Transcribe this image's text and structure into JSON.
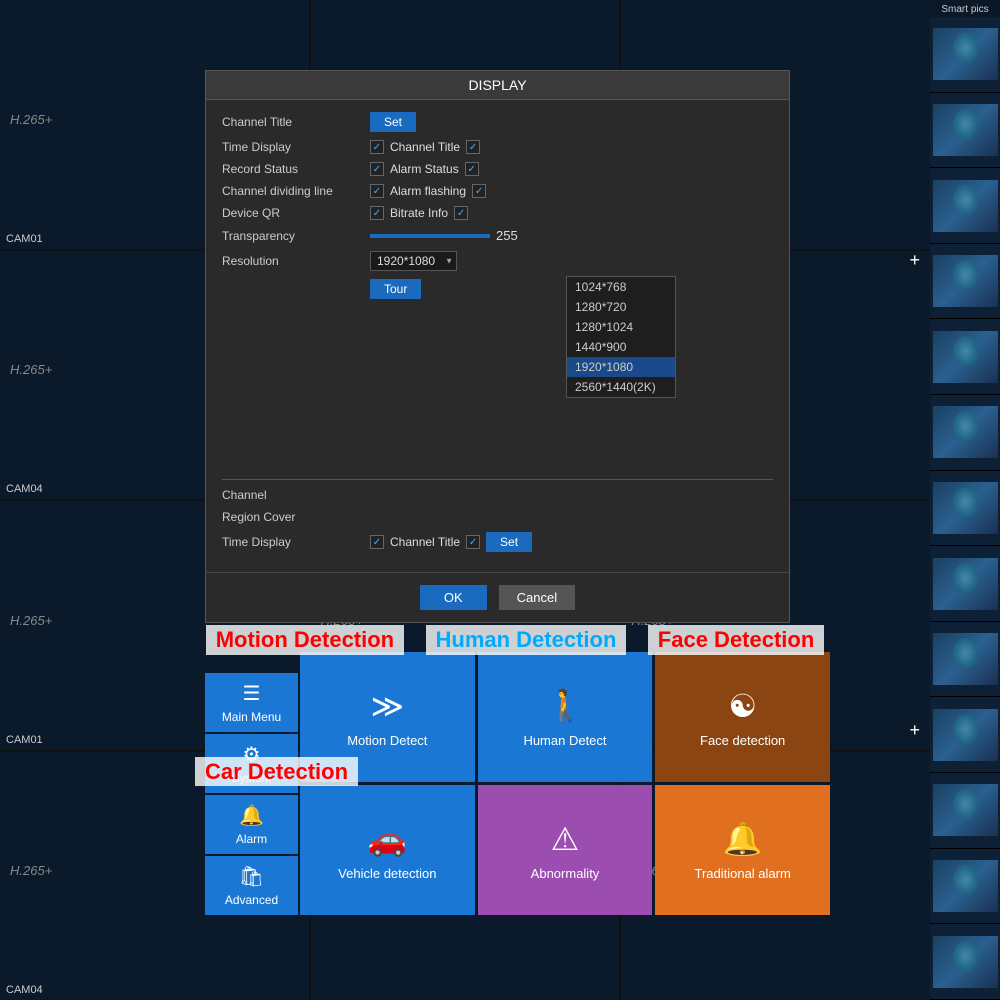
{
  "dialog": {
    "title": "DISPLAY",
    "channel_title_label": "Channel Title",
    "time_display_label": "Time Display",
    "record_status_label": "Record Status",
    "channel_dividing_label": "Channel dividing line",
    "device_qr_label": "Device QR",
    "transparency_label": "Transparency",
    "resolution_label": "Resolution",
    "channel_label": "Channel",
    "region_cover_label": "Region Cover",
    "time_display2_label": "Time Display",
    "set_button": "Set",
    "tour_button": "Tour",
    "set_button2": "Set",
    "ok_button": "OK",
    "cancel_button": "Cancel",
    "transparency_value": "255",
    "resolution_current": "1920*1080",
    "channel_title_checkbox": true,
    "alarm_status_label": "Alarm Status",
    "alarm_flashing_label": "Alarm flashing",
    "bitrate_info_label": "Bitrate Info",
    "resolution_options": [
      "1024*768",
      "1280*720",
      "1280*1024",
      "1440*900",
      "1920*1080",
      "2560*1440(2K)"
    ],
    "channel_title2_label": "Channel Title"
  },
  "side_menu": {
    "main_menu_label": "Main Menu",
    "system_label": "System",
    "alarm_label": "Alarm",
    "advanced_label": "Advanced"
  },
  "detection_grid": {
    "motion_detect_label": "Motion Detect",
    "human_detect_label": "Human Detect",
    "face_detection_label": "Face detection",
    "vehicle_detection_label": "Vehicle detection",
    "abnormality_label": "Abnormality",
    "traditional_alarm_label": "Traditional alarm"
  },
  "banners": {
    "motion_detection": "Motion Detection",
    "human_detection": "Human Detection",
    "face_detection": "Face Detection",
    "car_detection": "Car Detection"
  },
  "cameras": {
    "labels": [
      "H.265+",
      "H.265+",
      "H.265+",
      "H.265+",
      "H.265+",
      "H.265+",
      "H.265+",
      "H.265+",
      "H.265+",
      "H.265+",
      "H.265+",
      "H.265+"
    ],
    "ids": [
      "CAM01",
      "",
      "",
      "CAM04",
      "",
      "",
      "CAM01",
      "",
      "",
      "CAM04",
      "",
      ""
    ]
  },
  "smart_pics_label": "Smart pics",
  "cursor": "pointer"
}
